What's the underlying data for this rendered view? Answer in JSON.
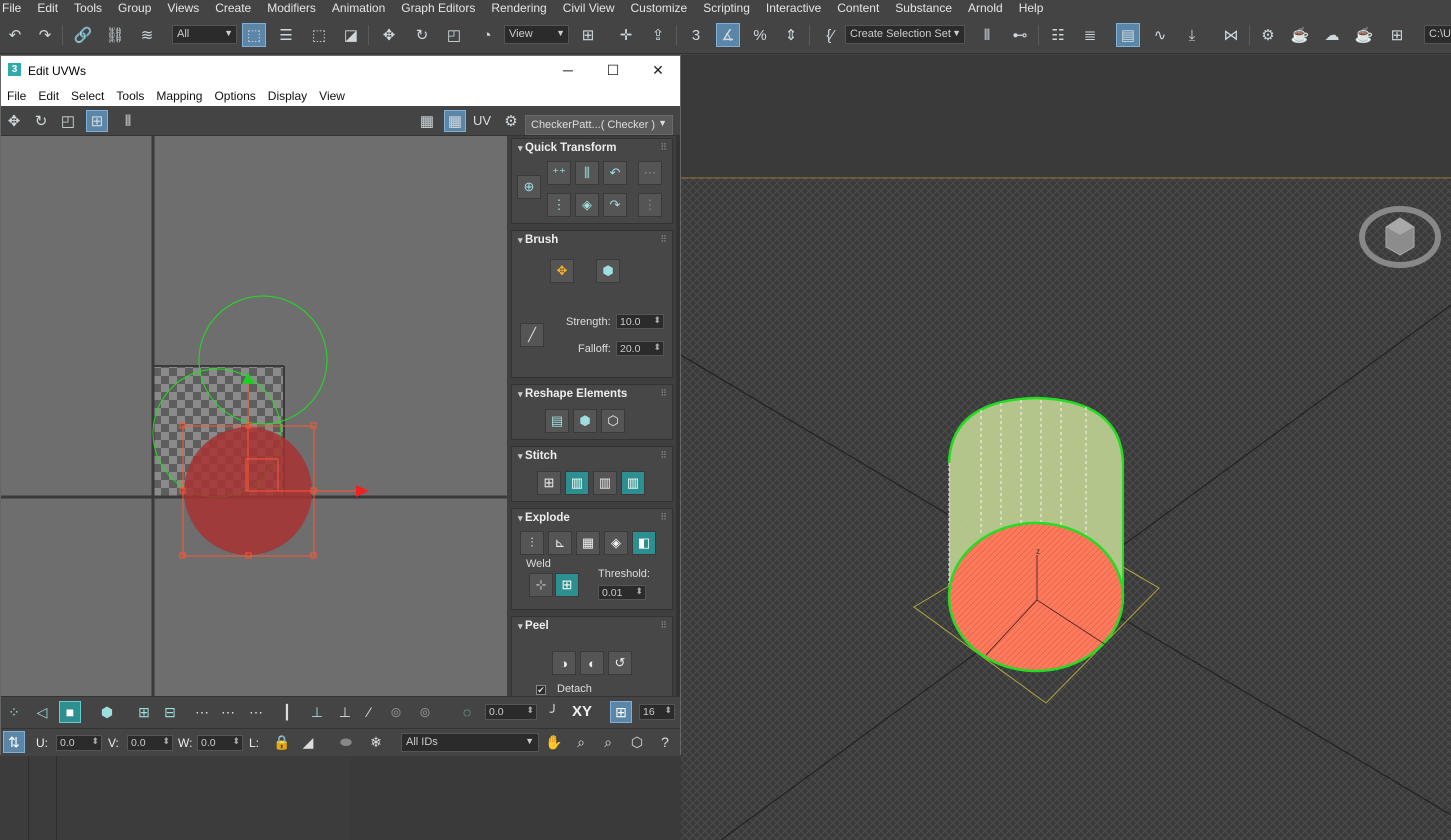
{
  "menubar": {
    "items": [
      "File",
      "Edit",
      "Tools",
      "Group",
      "Views",
      "Create",
      "Modifiers",
      "Animation",
      "Graph Editors",
      "Rendering",
      "Civil View",
      "Customize",
      "Scripting",
      "Interactive",
      "Content",
      "Substance",
      "Arnold",
      "Help"
    ]
  },
  "toolbar": {
    "filter_dropdown": "All",
    "view_dropdown": "View",
    "selection_set_dropdown": "Create Selection Set",
    "path_field": "C:\\Us"
  },
  "dialog": {
    "title": "Edit UVWs",
    "app_icon": "3",
    "minimize": "─",
    "maximize": "☐",
    "close": "✕",
    "menu": [
      "File",
      "Edit",
      "Select",
      "Tools",
      "Mapping",
      "Options",
      "Display",
      "View"
    ],
    "uv_label": "UV",
    "checker_dropdown": "CheckerPatt...( Checker )"
  },
  "panel": {
    "quick_transform": {
      "title": "Quick Transform"
    },
    "brush": {
      "title": "Brush",
      "strength_label": "Strength:",
      "strength_value": "10.0",
      "falloff_label": "Falloff:",
      "falloff_value": "20.0"
    },
    "reshape": {
      "title": "Reshape Elements"
    },
    "stitch": {
      "title": "Stitch"
    },
    "explode": {
      "title": "Explode",
      "weld_label": "Weld",
      "threshold_label": "Threshold:",
      "threshold_value": "0.01"
    },
    "peel": {
      "title": "Peel",
      "detach_label": "Detach",
      "detach_checked": "✔"
    }
  },
  "bottom": {
    "rotate_value": "0.0",
    "xy_label": "XY",
    "grid_value": "16",
    "u_label": "U:",
    "u_value": "0.0",
    "v_label": "V:",
    "v_value": "0.0",
    "w_label": "W:",
    "w_value": "0.0",
    "l_label": "L:",
    "ids_dropdown": "All IDs"
  },
  "colors": {
    "accent_blue": "#5b86a8",
    "accent_teal": "#2d8f8f",
    "uv_shell_fill": "#a83232",
    "cylinder_cap": "#ff7a5c",
    "selection_green": "#22dd22"
  }
}
